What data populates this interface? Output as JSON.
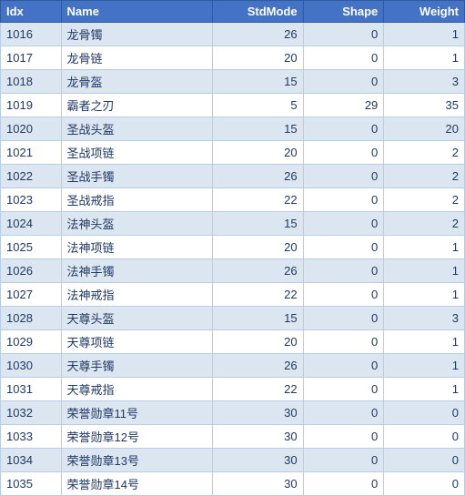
{
  "table": {
    "headers": [
      {
        "key": "idx",
        "label": "Idx",
        "align": "left"
      },
      {
        "key": "name",
        "label": "Name",
        "align": "left"
      },
      {
        "key": "stdmode",
        "label": "StdMode",
        "align": "right"
      },
      {
        "key": "shape",
        "label": "Shape",
        "align": "right"
      },
      {
        "key": "weight",
        "label": "Weight",
        "align": "right"
      }
    ],
    "rows": [
      {
        "idx": "1016",
        "name": "龙骨镯",
        "stdmode": "26",
        "shape": "0",
        "weight": "1"
      },
      {
        "idx": "1017",
        "name": "龙骨链",
        "stdmode": "20",
        "shape": "0",
        "weight": "1"
      },
      {
        "idx": "1018",
        "name": "龙骨盔",
        "stdmode": "15",
        "shape": "0",
        "weight": "3"
      },
      {
        "idx": "1019",
        "name": "霸者之刃",
        "stdmode": "5",
        "shape": "29",
        "weight": "35"
      },
      {
        "idx": "1020",
        "name": "圣战头盔",
        "stdmode": "15",
        "shape": "0",
        "weight": "20"
      },
      {
        "idx": "1021",
        "name": "圣战项链",
        "stdmode": "20",
        "shape": "0",
        "weight": "2"
      },
      {
        "idx": "1022",
        "name": "圣战手镯",
        "stdmode": "26",
        "shape": "0",
        "weight": "2"
      },
      {
        "idx": "1023",
        "name": "圣战戒指",
        "stdmode": "22",
        "shape": "0",
        "weight": "2"
      },
      {
        "idx": "1024",
        "name": "法神头盔",
        "stdmode": "15",
        "shape": "0",
        "weight": "2"
      },
      {
        "idx": "1025",
        "name": "法神项链",
        "stdmode": "20",
        "shape": "0",
        "weight": "1"
      },
      {
        "idx": "1026",
        "name": "法神手镯",
        "stdmode": "26",
        "shape": "0",
        "weight": "1"
      },
      {
        "idx": "1027",
        "name": "法神戒指",
        "stdmode": "22",
        "shape": "0",
        "weight": "1"
      },
      {
        "idx": "1028",
        "name": "天尊头盔",
        "stdmode": "15",
        "shape": "0",
        "weight": "3"
      },
      {
        "idx": "1029",
        "name": "天尊项链",
        "stdmode": "20",
        "shape": "0",
        "weight": "1"
      },
      {
        "idx": "1030",
        "name": "天尊手镯",
        "stdmode": "26",
        "shape": "0",
        "weight": "1"
      },
      {
        "idx": "1031",
        "name": "天尊戒指",
        "stdmode": "22",
        "shape": "0",
        "weight": "1"
      },
      {
        "idx": "1032",
        "name": "荣誉勋章11号",
        "stdmode": "30",
        "shape": "0",
        "weight": "0"
      },
      {
        "idx": "1033",
        "name": "荣誉勋章12号",
        "stdmode": "30",
        "shape": "0",
        "weight": "0"
      },
      {
        "idx": "1034",
        "name": "荣誉勋章13号",
        "stdmode": "30",
        "shape": "0",
        "weight": "0"
      },
      {
        "idx": "1035",
        "name": "荣誉勋章14号",
        "stdmode": "30",
        "shape": "0",
        "weight": "0"
      }
    ]
  }
}
